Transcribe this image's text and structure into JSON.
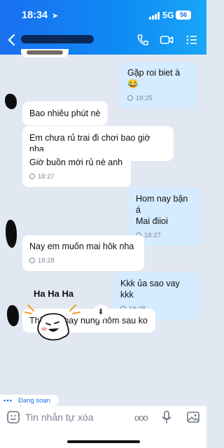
{
  "status_bar": {
    "time": "18:34",
    "network": "5G",
    "battery": "56"
  },
  "header": {},
  "messages": [
    {
      "side": "right",
      "text": "Gặp roi biet à 😂",
      "time": "18:25"
    },
    {
      "side": "left",
      "text": "Bao nhiêu phút nè"
    },
    {
      "side": "left",
      "text": "Em chưa rủ trai đi chơi bao giờ nha"
    },
    {
      "side": "left",
      "text": "Giờ buồn mới rủ nè anh",
      "time": "18:27"
    },
    {
      "side": "right",
      "text": "Hom nay bận á",
      "text2": "Mai điioi",
      "time": "18:27"
    },
    {
      "side": "left",
      "text": "Nay em muốn mai hôk  nha",
      "time": "18:28"
    },
    {
      "side": "right",
      "text": "Kkk ủa sao vay kkk",
      "time": "18:28"
    },
    {
      "side": "left",
      "text": "Thì hôm nay nung hôm sau ko"
    }
  ],
  "sticker": {
    "text": "Ha Ha Ha"
  },
  "typing_indicator": {
    "dots": "•••",
    "text": "Đang soạn tin"
  },
  "composer": {
    "placeholder": "Tin nhắn tự xóa",
    "more": "ooo"
  },
  "colors": {
    "header": "#1a6ff0",
    "outgoing": "#d5ebff",
    "incoming": "#ffffff",
    "background": "#e2e8f1"
  }
}
